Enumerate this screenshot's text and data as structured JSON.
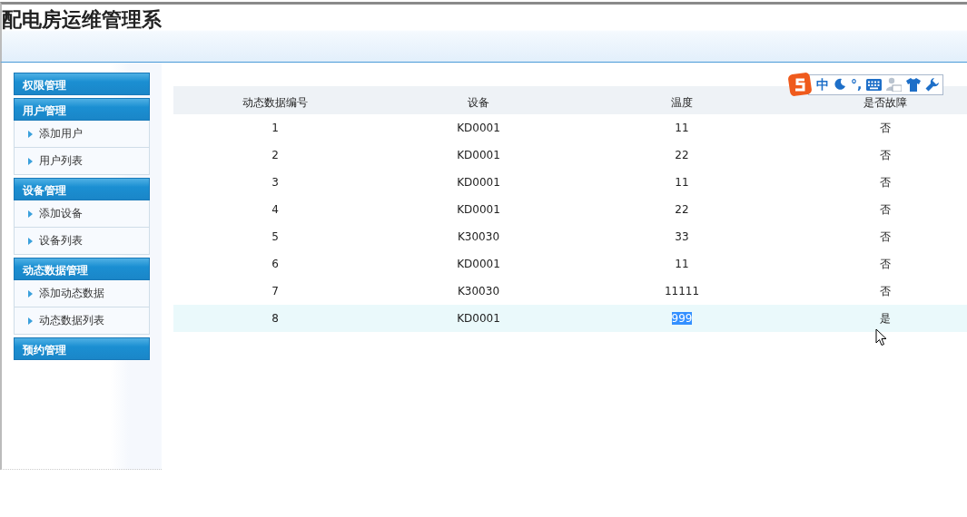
{
  "header": {
    "title": "配电房运维管理系"
  },
  "sidebar": {
    "groups": [
      {
        "title": "权限管理"
      },
      {
        "title": "用户管理",
        "items": [
          "添加用户",
          "用户列表"
        ]
      },
      {
        "title": "设备管理",
        "items": [
          "添加设备",
          "设备列表"
        ]
      },
      {
        "title": "动态数据管理",
        "items": [
          "添加动态数据",
          "动态数据列表"
        ]
      },
      {
        "title": "预约管理"
      }
    ]
  },
  "table": {
    "columns": [
      "动态数据编号",
      "设备",
      "温度",
      "是否故障"
    ],
    "rows": [
      {
        "cells": [
          "1",
          "KD0001",
          "11",
          "否"
        ],
        "hovered": false,
        "temperature_selected": false
      },
      {
        "cells": [
          "2",
          "KD0001",
          "22",
          "否"
        ],
        "hovered": false,
        "temperature_selected": false
      },
      {
        "cells": [
          "3",
          "KD0001",
          "11",
          "否"
        ],
        "hovered": false,
        "temperature_selected": false
      },
      {
        "cells": [
          "4",
          "KD0001",
          "22",
          "否"
        ],
        "hovered": false,
        "temperature_selected": false
      },
      {
        "cells": [
          "5",
          "K30030",
          "33",
          "否"
        ],
        "hovered": false,
        "temperature_selected": false
      },
      {
        "cells": [
          "6",
          "KD0001",
          "11",
          "否"
        ],
        "hovered": false,
        "temperature_selected": false
      },
      {
        "cells": [
          "7",
          "K30030",
          "11111",
          "否"
        ],
        "hovered": false,
        "temperature_selected": false
      },
      {
        "cells": [
          "8",
          "KD0001",
          "999",
          "是"
        ],
        "hovered": true,
        "temperature_selected": true
      }
    ]
  },
  "ime_toolbar": {
    "mode": "中",
    "punctuation": "°,"
  }
}
